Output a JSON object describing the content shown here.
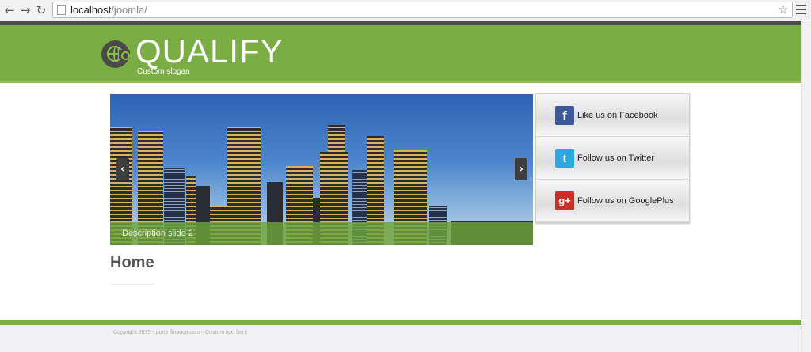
{
  "browser": {
    "url_host": "localhost",
    "url_path": "/joomla/"
  },
  "header": {
    "title": "QUALIFY",
    "slogan": "Custom slogan",
    "colors": {
      "brand_green": "#7aad43",
      "top_bar": "#4b4b4b"
    }
  },
  "slider": {
    "caption": "Description slide 2",
    "prev_icon": "chevron-left-icon",
    "next_icon": "chevron-right-icon"
  },
  "social": {
    "items": [
      {
        "label": "Like us on Facebook",
        "icon": "facebook-icon",
        "glyph": "f",
        "color": "#3b5998"
      },
      {
        "label": "Follow us on Twitter",
        "icon": "twitter-icon",
        "glyph": "t",
        "color": "#2aa9e0"
      },
      {
        "label": "Follow us on GooglePlus",
        "icon": "googleplus-icon",
        "glyph": "g+",
        "color": "#c9302c"
      }
    ]
  },
  "content": {
    "heading": "Home"
  },
  "footer": {
    "copyright": "Copyright 2015 - porterfinance.com - Custom text here"
  }
}
